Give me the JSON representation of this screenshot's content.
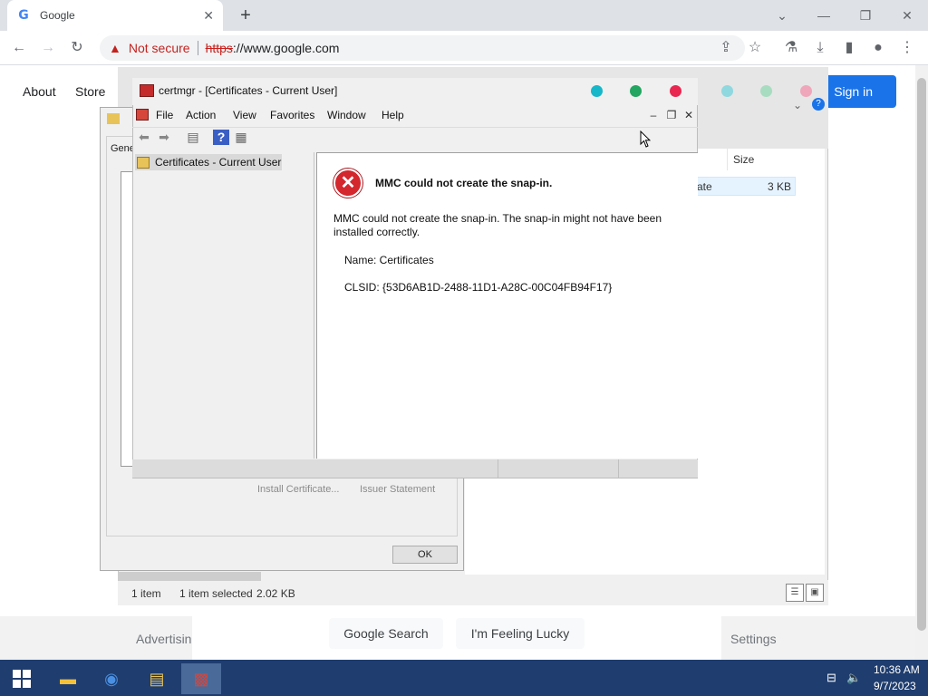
{
  "browser": {
    "tab_title": "Google",
    "url_https": "https",
    "url_rest": "://www.google.com",
    "not_secure": "Not secure",
    "new_tab": "+",
    "tab_close": "✕"
  },
  "google": {
    "about": "About",
    "store": "Store",
    "sign_in": "Sign in",
    "search_button": "Google Search",
    "lucky_button": "I'm Feeling Lucky",
    "advertising": "Advertisin",
    "settings": "Settings"
  },
  "explorer": {
    "col_size": "Size",
    "row_type": "ate",
    "row_size": "3 KB",
    "status_count": "1 item",
    "status_selected": "1 item selected",
    "status_size": "2.02 KB"
  },
  "cert_dialog": {
    "tab_label": "Gene",
    "install_button": "Install Certificate...",
    "issuer_button": "Issuer Statement",
    "ok_button": "OK"
  },
  "mmc": {
    "title": "certmgr - [Certificates - Current User]",
    "menu": [
      "File",
      "Action",
      "View",
      "Favorites",
      "Window",
      "Help"
    ],
    "tree_item": "Certificates - Current User",
    "error_title": "MMC could not create the snap-in.",
    "error_message": "MMC could not create the snap-in. The snap-in might not have been installed correctly.",
    "error_name": "Name: Certificates",
    "error_clsid": "CLSID: {53D6AB1D-2488-11D1-A28C-00C04FB94F17}"
  },
  "taskbar": {
    "time": "10:36 AM",
    "date": "9/7/2023"
  },
  "colors": {
    "chrome_blue": "#1a73e8",
    "not_secure_red": "#c5221f",
    "error_red": "#d3262d",
    "taskbar": "#1f3d6e",
    "dot_teal": "#16b7c9",
    "dot_green": "#22a661",
    "dot_red": "#e8264f"
  }
}
